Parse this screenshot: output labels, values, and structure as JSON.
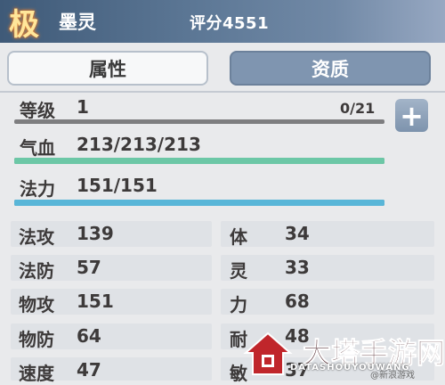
{
  "header": {
    "grade": "极",
    "pet_name": "墨灵",
    "score": "评分4551"
  },
  "tabs": [
    {
      "label": "属性",
      "active": true
    },
    {
      "label": "资质",
      "active": false
    }
  ],
  "level": {
    "label": "等级",
    "value": "1",
    "exp": "0/21",
    "exp_fraction": 0.0,
    "add_icon": "plus-icon",
    "add_symbol": "+"
  },
  "hp": {
    "label": "气血",
    "value": "213/213/213",
    "fraction": 1.0
  },
  "mp": {
    "label": "法力",
    "value": "151/151",
    "fraction": 1.0
  },
  "stats_left": [
    {
      "label": "法攻",
      "value": "139"
    },
    {
      "label": "法防",
      "value": "57"
    },
    {
      "label": "物攻",
      "value": "151"
    },
    {
      "label": "物防",
      "value": "64"
    },
    {
      "label": "速度",
      "value": "47"
    }
  ],
  "stats_right": [
    {
      "label": "体",
      "value": "34"
    },
    {
      "label": "灵",
      "value": "33"
    },
    {
      "label": "力",
      "value": "68"
    },
    {
      "label": "耐",
      "value": "48"
    },
    {
      "label": "敏",
      "value": "37"
    }
  ],
  "watermark": {
    "text": "大塔手游网",
    "subtext": "DATASHOUYOUWANG",
    "corner": "@新浪游戏"
  },
  "colors": {
    "header": "#5d7896",
    "hp_bar": "#6cc7a6",
    "mp_bar": "#59b6d8",
    "exp_bar": "#7e7e80"
  }
}
